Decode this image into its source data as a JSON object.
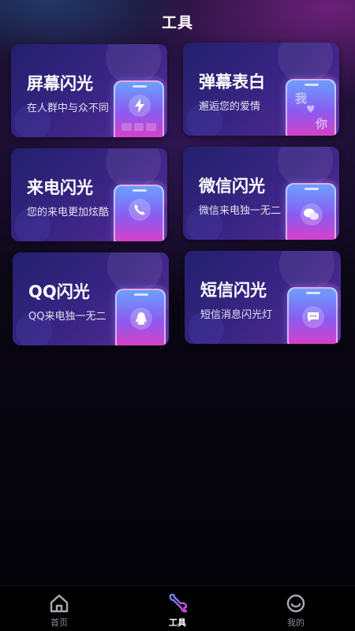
{
  "header": {
    "title": "工具"
  },
  "cards": [
    {
      "title": "屏幕闪光",
      "subtitle": "在人群中与众不同"
    },
    {
      "title": "弹幕表白",
      "subtitle": "邂逅您的爱情",
      "barrage_chars": [
        "我",
        "♥",
        "你"
      ]
    },
    {
      "title": "来电闪光",
      "subtitle": "您的来电更加炫酷"
    },
    {
      "title": "微信闪光",
      "subtitle": "微信来电独一无二"
    },
    {
      "title": "QQ闪光",
      "subtitle": "QQ来电独一无二"
    },
    {
      "title": "短信闪光",
      "subtitle": "短信消息闪光灯"
    }
  ],
  "tabbar": {
    "items": [
      {
        "label": "首页",
        "icon": "home-icon"
      },
      {
        "label": "工具",
        "icon": "wrench-icon",
        "active": true
      },
      {
        "label": "我的",
        "icon": "smile-icon"
      }
    ]
  },
  "colors": {
    "background": "#05040a",
    "card_start": "#23206e",
    "card_end": "#5a2a94",
    "phone_top": "#6aa0ff",
    "phone_bottom": "#d640c8",
    "tab_active": "#ffffff",
    "tab_inactive": "#8b8b95"
  }
}
